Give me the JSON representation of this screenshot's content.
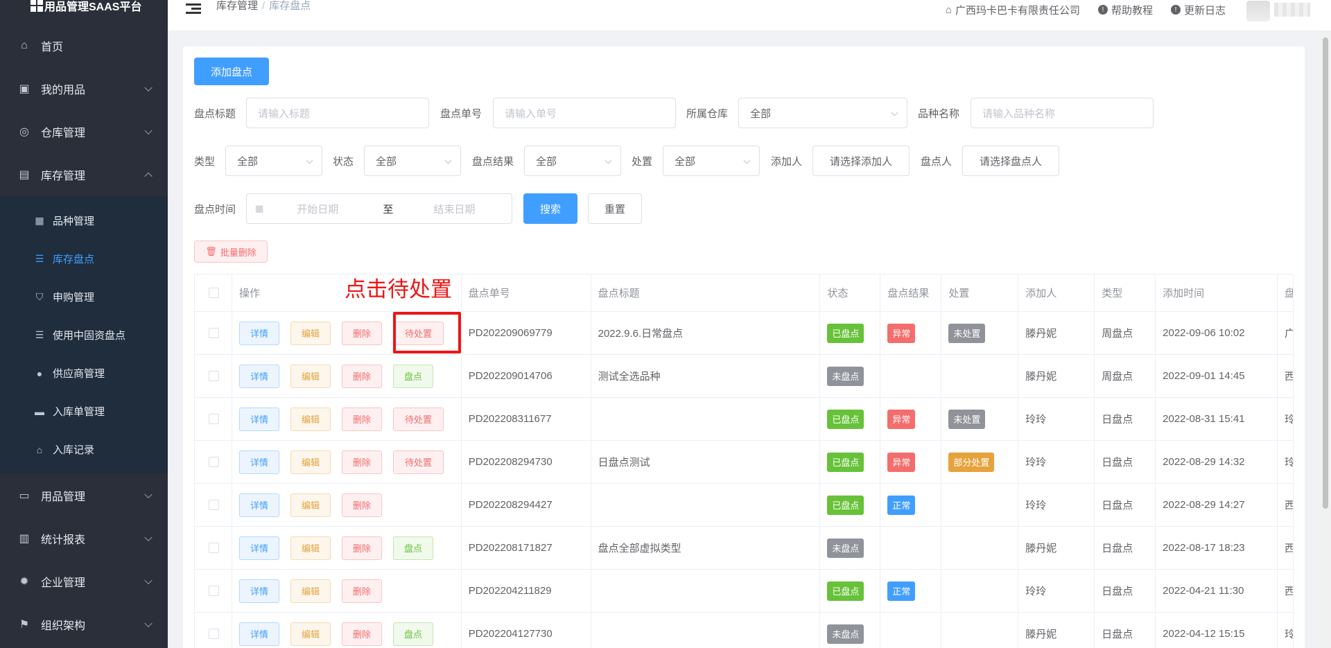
{
  "sidebar": {
    "brand": "用品管理SAAS平台",
    "items": [
      {
        "label": "首页",
        "icon": "home-icon"
      },
      {
        "label": "我的用品",
        "icon": "bag-icon"
      },
      {
        "label": "仓库管理",
        "icon": "database-icon"
      },
      {
        "label": "库存管理",
        "icon": "box-icon"
      }
    ],
    "sub_items": [
      {
        "label": "品种管理",
        "icon": "grid-icon"
      },
      {
        "label": "库存盘点",
        "icon": "document-icon"
      },
      {
        "label": "申购管理",
        "icon": "shopping-bag-icon"
      },
      {
        "label": "使用中固资盘点",
        "icon": "document-icon"
      },
      {
        "label": "供应商管理",
        "icon": "user-icon"
      },
      {
        "label": "入库单管理",
        "icon": "printer-icon"
      },
      {
        "label": "入库记录",
        "icon": "home-icon"
      }
    ],
    "bottom_items": [
      {
        "label": "用品管理",
        "icon": "inbox-icon"
      },
      {
        "label": "统计报表",
        "icon": "bar-chart-icon"
      },
      {
        "label": "企业管理",
        "icon": "gear-icon"
      },
      {
        "label": "组织架构",
        "icon": "flag-icon"
      }
    ]
  },
  "header": {
    "breadcrumb_1": "库存管理",
    "breadcrumb_sep": "/",
    "breadcrumb_2": "库存盘点",
    "company": "广西玛卡巴卡有限责任公司",
    "help": "帮助教程",
    "changelog": "更新日志"
  },
  "toolbar": {
    "add_label": "添加盘点",
    "batch_delete_label": "批量删除"
  },
  "filters": {
    "title_label": "盘点标题",
    "title_placeholder": "请输入标题",
    "no_label": "盘点单号",
    "no_placeholder": "请输入单号",
    "warehouse_label": "所属仓库",
    "warehouse_value": "全部",
    "variety_label": "品种名称",
    "variety_placeholder": "请输入品种名称",
    "type_label": "类型",
    "type_value": "全部",
    "status_label": "状态",
    "status_value": "全部",
    "result_label": "盘点结果",
    "result_value": "全部",
    "handle_label": "处置",
    "handle_value": "全部",
    "adder_label": "添加人",
    "adder_button": "请选择添加人",
    "checker_label": "盘点人",
    "checker_button": "请选择盘点人",
    "time_label": "盘点时间",
    "start_placeholder": "开始日期",
    "range_sep": "至",
    "end_placeholder": "结束日期",
    "search_label": "搜索",
    "reset_label": "重置"
  },
  "table": {
    "columns": [
      "操作",
      "盘点单号",
      "盘点标题",
      "状态",
      "盘点结果",
      "处置",
      "添加人",
      "类型",
      "添加时间",
      "盘"
    ],
    "op_labels": {
      "detail": "详情",
      "edit": "编辑",
      "delete": "删除",
      "pending": "待处置",
      "check": "盘点"
    },
    "rows": [
      {
        "action": "pending",
        "no": "PD202209069779",
        "title": "2022.9.6.日常盘点",
        "status": "已盘点",
        "status_color": "green",
        "result": "异常",
        "result_color": "red",
        "handle": "未处置",
        "handle_color": "gray",
        "adder": "滕丹妮",
        "type": "周盘点",
        "time": "2022-09-06 10:02",
        "extra": "广"
      },
      {
        "action": "check",
        "no": "PD202209014706",
        "title": "测试全选品种",
        "status": "未盘点",
        "status_color": "gray",
        "result": "",
        "result_color": "",
        "handle": "",
        "handle_color": "",
        "adder": "滕丹妮",
        "type": "周盘点",
        "time": "2022-09-01 14:45",
        "extra": "西"
      },
      {
        "action": "pending",
        "no": "PD202208311677",
        "title": "",
        "status": "已盘点",
        "status_color": "green",
        "result": "异常",
        "result_color": "red",
        "handle": "未处置",
        "handle_color": "gray",
        "adder": "玲玲",
        "type": "日盘点",
        "time": "2022-08-31 15:41",
        "extra": "玲"
      },
      {
        "action": "pending",
        "no": "PD202208294730",
        "title": "日盘点测试",
        "status": "已盘点",
        "status_color": "green",
        "result": "异常",
        "result_color": "red",
        "handle": "部分处置",
        "handle_color": "orange",
        "adder": "玲玲",
        "type": "日盘点",
        "time": "2022-08-29 14:32",
        "extra": "玲"
      },
      {
        "action": "none",
        "no": "PD202208294427",
        "title": "",
        "status": "已盘点",
        "status_color": "green",
        "result": "正常",
        "result_color": "blue",
        "handle": "",
        "handle_color": "",
        "adder": "玲玲",
        "type": "日盘点",
        "time": "2022-08-29 14:27",
        "extra": "西"
      },
      {
        "action": "check",
        "no": "PD202208171827",
        "title": "盘点全部虚拟类型",
        "status": "未盘点",
        "status_color": "gray",
        "result": "",
        "result_color": "",
        "handle": "",
        "handle_color": "",
        "adder": "滕丹妮",
        "type": "日盘点",
        "time": "2022-08-17 18:23",
        "extra": "西"
      },
      {
        "action": "none",
        "no": "PD202204211829",
        "title": "",
        "status": "已盘点",
        "status_color": "green",
        "result": "正常",
        "result_color": "blue",
        "handle": "",
        "handle_color": "",
        "adder": "玲玲",
        "type": "日盘点",
        "time": "2022-04-21 11:30",
        "extra": "西"
      },
      {
        "action": "check",
        "no": "PD202204127730",
        "title": "",
        "status": "未盘点",
        "status_color": "gray",
        "result": "",
        "result_color": "",
        "handle": "",
        "handle_color": "",
        "adder": "滕丹妮",
        "type": "日盘点",
        "time": "2022-04-12 15:15",
        "extra": "玲"
      }
    ]
  },
  "annotation": {
    "text": "点击待处置"
  },
  "colors": {
    "primary": "#409eff",
    "sidebar_bg": "#2b2f3a",
    "annotation": "#f01414"
  }
}
